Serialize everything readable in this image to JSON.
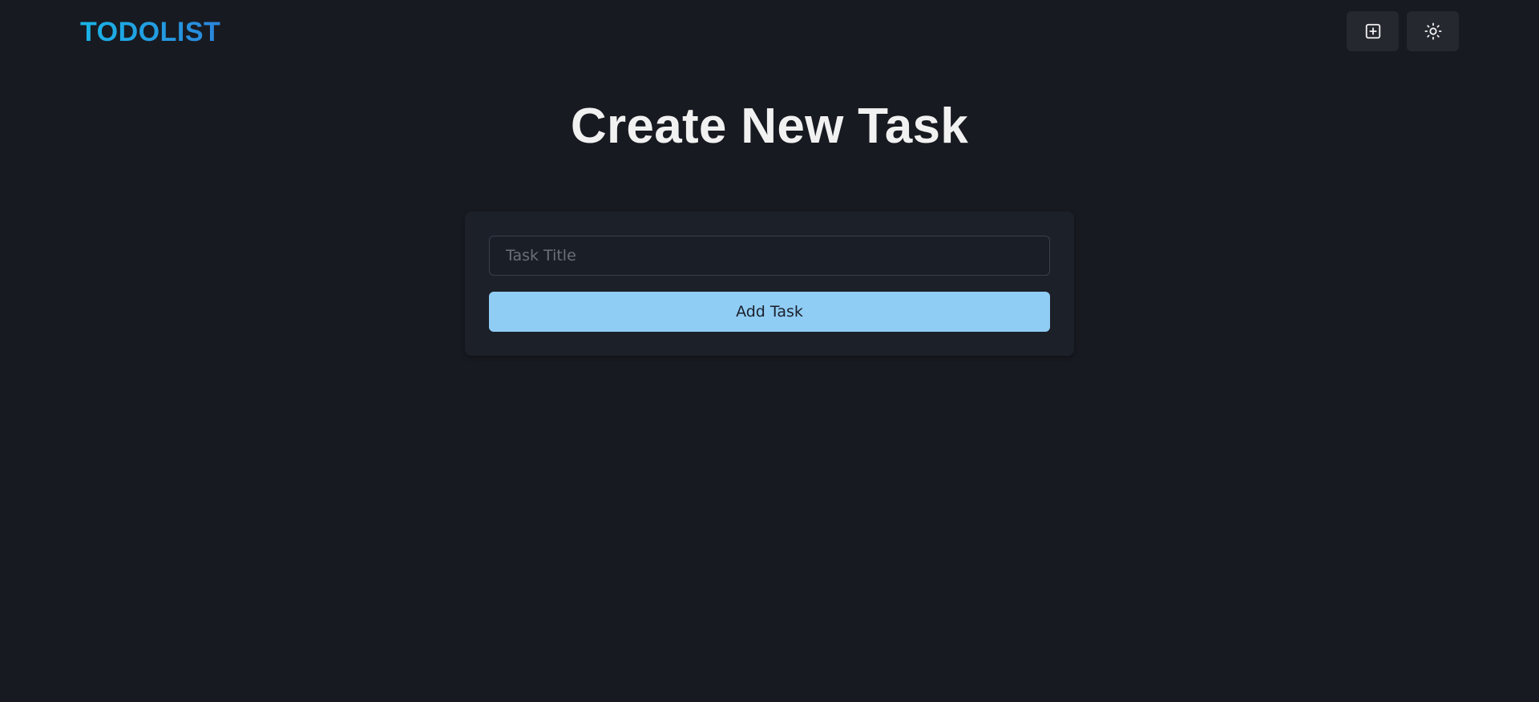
{
  "header": {
    "logo": "TODOLIST",
    "new_task_icon": "plus-square-icon",
    "theme_icon": "sun-icon"
  },
  "main": {
    "title": "Create New Task",
    "form": {
      "title_placeholder": "Task Title",
      "title_value": "",
      "submit_label": "Add Task"
    }
  },
  "colors": {
    "background": "#181a21",
    "card": "#1c2029",
    "accent_button": "#90cdf4",
    "logo_gradient_start": "#19b5e8",
    "logo_gradient_end": "#2b86db",
    "icon_button": "#262830"
  }
}
